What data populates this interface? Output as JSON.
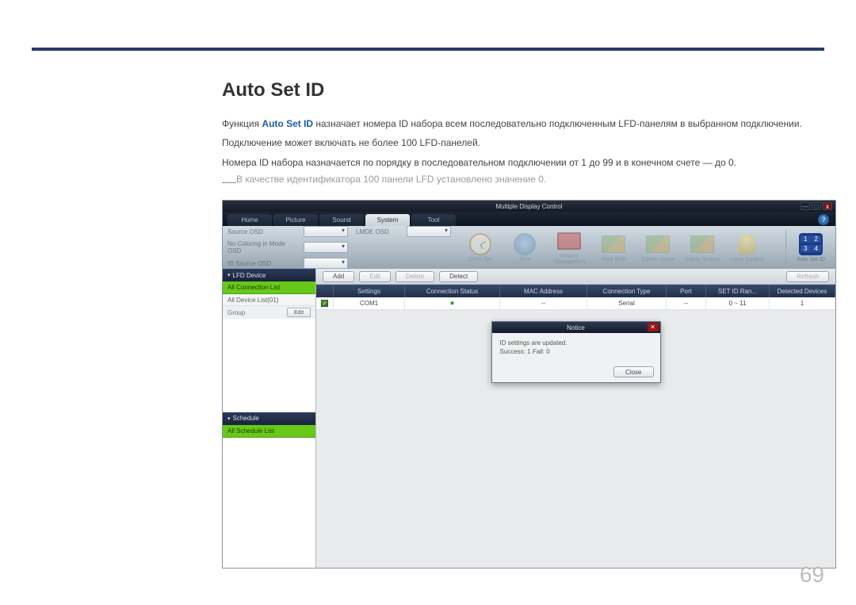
{
  "heading": "Auto Set ID",
  "para1_prefix": "Функция ",
  "para1_hl": "Auto Set ID",
  "para1_suffix": " назначает номера ID набора всем последовательно подключенным LFD-панелям в выбранном подключении.",
  "para2": "Подключение может включать не более 100 LFD-панелей.",
  "para3": "Номера ID набора назначается по порядку в последовательном подключении от 1 до 99 и в конечном счете — до 0.",
  "note": "В качестве идентификатора 100 панели LFD установлено значение 0.",
  "page_number": "69",
  "app": {
    "title": "Multiple Display Control",
    "win": {
      "min": "—",
      "max": "□",
      "close": "x"
    },
    "tabs": [
      "Home",
      "Picture",
      "Sound",
      "System",
      "Tool"
    ],
    "active_tab_index": 3,
    "help": "?",
    "osd": {
      "row1_label": "Source OSD",
      "row1b_label": "LMDE OSD",
      "row2_label": "No Coloring in Mode OSD",
      "row3_label": "ID Source OSD"
    },
    "toolicons": [
      {
        "label": "Clock Set"
      },
      {
        "label": "Time"
      },
      {
        "label": "Holiday Management"
      },
      {
        "label": "Pixel Shift"
      },
      {
        "label": "Screen Saver"
      },
      {
        "label": "Safety Screen"
      },
      {
        "label": "Lamp Control"
      },
      {
        "label": "Auto Set ID"
      }
    ],
    "sidebar": {
      "lfd_header": "LFD Device",
      "all_conn": "All Connection List",
      "all_dev": "All Device List(01)",
      "group": "Group",
      "edit": "Edit",
      "sched_header": "Schedule",
      "all_sched": "All Schedule List"
    },
    "buttons": {
      "add": "Add",
      "edit": "Edit",
      "delete": "Delete",
      "detect": "Detect",
      "refresh": "Refresh"
    },
    "columns": {
      "settings": "Settings",
      "conn": "Connection Status",
      "mac": "MAC Address",
      "type": "Connection Type",
      "port": "Port",
      "range": "SET ID Ran...",
      "detected": "Detected Devices"
    },
    "row": {
      "settings": "COM1",
      "conn": "●",
      "mac": "--",
      "type": "Serial",
      "port": "--",
      "range": "0 ~ 11",
      "detected": "1"
    },
    "dialog": {
      "title": "Notice",
      "line1": "ID settings are updated.",
      "line2": "Success: 1  Fail: 0",
      "close": "Close"
    }
  }
}
